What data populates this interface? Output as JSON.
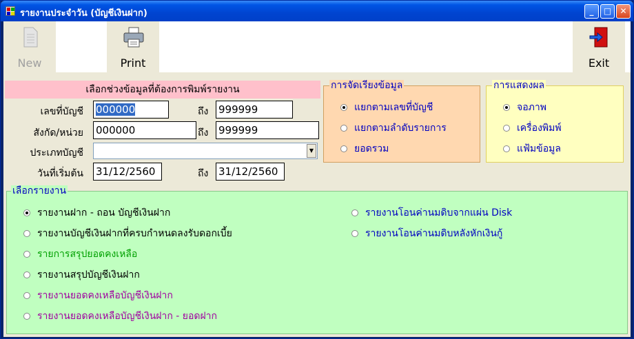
{
  "window": {
    "title": "รายงานประจำวัน (บัญชีเงินฝาก)",
    "min": "_",
    "max": "□",
    "close": "✕"
  },
  "toolbar": {
    "new_label": "New",
    "print_label": "Print",
    "exit_label": "Exit"
  },
  "range": {
    "header": "เลือกช่วงข้อมูลที่ต้องการพิมพ์รายงาน",
    "account_label": "เลขที่บัญชี",
    "account_from": "000000",
    "account_to": "999999",
    "unit_label": "สังกัด/หน่วย",
    "unit_from": "000000",
    "unit_to": "999999",
    "type_label": "ประเภทบัญชี",
    "type_value": "",
    "start_label": "วันที่เริ่มต้น",
    "date_from": "31/12/2560",
    "date_to": "31/12/2560",
    "to_label": "ถึง"
  },
  "sort": {
    "title": "การจัดเรียงข้อมูล",
    "options": [
      "แยกตามเลขที่บัญชี",
      "แยกตามลำดับรายการ",
      "ยอดรวม"
    ],
    "selected": 0
  },
  "output": {
    "title": "การแสดงผล",
    "options": [
      "จอภาพ",
      "เครื่องพิมพ์",
      "แฟ้มข้อมูล"
    ],
    "selected": 0
  },
  "reports": {
    "title": "เลือกรายงาน",
    "left": [
      "รายงานฝาก - ถอน บัญชีเงินฝาก",
      "รายงานบัญชีเงินฝากที่ครบกำหนดลงรับดอกเบี้ย",
      "รายการสรุปยอดคงเหลือ",
      "รายงานสรุปบัญชีเงินฝาก",
      "รายงานยอดคงเหลือบัญชีเงินฝาก",
      "รายงานยอดคงเหลือบัญชีเงินฝาก - ยอดฝาก"
    ],
    "right": [
      "รายงานโอนค่านมดิบจากแผ่น Disk",
      "รายงานโอนค่านมดิบหลังหักเงินกู้"
    ],
    "colors": {
      "black": "#000000",
      "green": "#00a000",
      "purple": "#a000a0",
      "blue": "#0000c0"
    }
  }
}
